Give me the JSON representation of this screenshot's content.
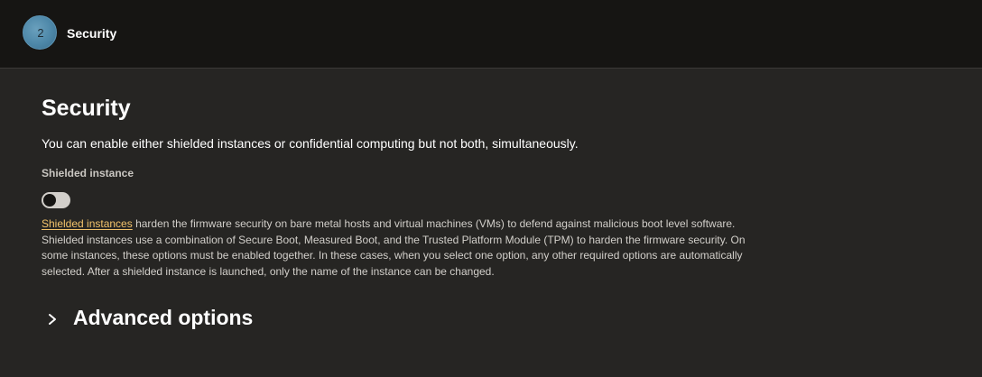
{
  "header": {
    "step_number": "2",
    "title": "Security"
  },
  "section": {
    "heading": "Security",
    "intro": "You can enable either shielded instances or confidential computing but not both, simultaneously."
  },
  "shielded_instance": {
    "label": "Shielded instance",
    "toggle_state": "off",
    "link_text": "Shielded instances",
    "description": " harden the firmware security on bare metal hosts and virtual machines (VMs) to defend against malicious boot level software. Shielded instances use a combination of Secure Boot, Measured Boot, and the Trusted Platform Module (TPM) to harden the firmware security. On some instances, these options must be enabled together. In these cases, when you select one option, any other required options are automatically selected. After a shielded instance is launched, only the name of the instance can be changed."
  },
  "advanced": {
    "label": "Advanced options",
    "icon": "chevron-right-icon",
    "expanded": false
  },
  "colors": {
    "background": "#262523",
    "topbar": "#161513",
    "link": "#f3c36b",
    "step_badge": "#4d87a8"
  }
}
